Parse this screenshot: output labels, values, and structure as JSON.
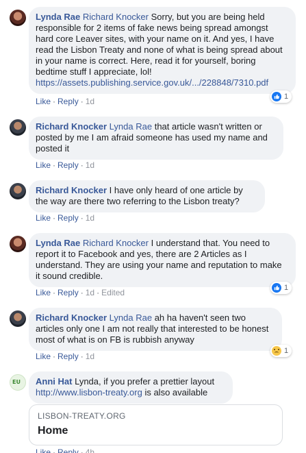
{
  "comments": [
    {
      "author": "Lynda Rae",
      "tag": "Richard Knocker",
      "text": "Sorry, but you are being held responsible for 2 items of fake news being spread amongst hard core Leaver sites, with your name on it. And yes, I have read the Lisbon Treaty and none of what is being spread about in your name is correct. Here, read it for yourself, boring bedtime stuff I appreciate, lol!",
      "link": "https://assets.publishing.service.gov.uk/.../228848/7310.pdf",
      "like": "Like",
      "reply": "Reply",
      "time": "1d",
      "reaction_count": "1",
      "reaction_icon": "like-icon"
    },
    {
      "author": "Richard Knocker",
      "tag": "Lynda Rae",
      "text": "that article wasn't written or posted by me I am afraid someone has used my name and posted it",
      "like": "Like",
      "reply": "Reply",
      "time": "1d"
    },
    {
      "author": "Richard Knocker",
      "text": "I have only heard of one article by the way are there two referring to the Lisbon treaty?",
      "like": "Like",
      "reply": "Reply",
      "time": "1d"
    },
    {
      "author": "Lynda Rae",
      "tag": "Richard Knocker",
      "text": "I understand that. You need to report it to Facebook and yes, there are 2 Articles as I understand. They are using your name and reputation to make it sound credible.",
      "like": "Like",
      "reply": "Reply",
      "time": "1d",
      "edited": "Edited",
      "reaction_count": "1",
      "reaction_icon": "like-icon"
    },
    {
      "author": "Richard Knocker",
      "tag": "Lynda Rae",
      "text": "ah ha haven't seen two articles only one I am not really that interested to be honest most of what is on FB is rubbish anyway",
      "like": "Like",
      "reply": "Reply",
      "time": "1d",
      "reaction_count": "1",
      "reaction_icon": "sad-icon"
    },
    {
      "author": "Anni Hat",
      "text": "Lynda, if you prefer a prettier layout",
      "link": "http://www.lisbon-treaty.org",
      "text_after": "is also available",
      "like": "Like",
      "reply": "Reply",
      "time": "4h"
    }
  ],
  "link_preview": {
    "domain": "LISBON-TREATY.ORG",
    "title": "Home"
  },
  "colors": {
    "link": "#385898",
    "bubble": "#f0f2f5",
    "like_blue": "#1877f2"
  }
}
